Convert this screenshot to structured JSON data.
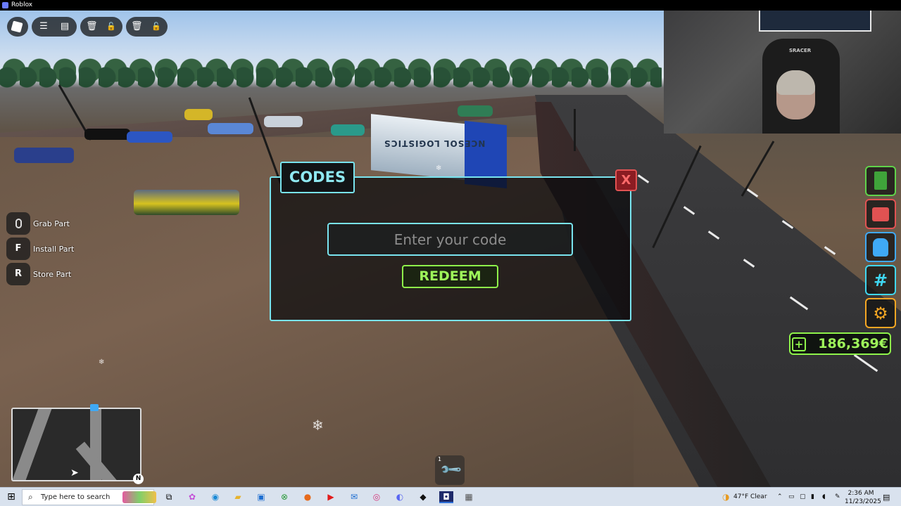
{
  "window": {
    "title": "Roblox"
  },
  "game": {
    "keybinds": [
      {
        "key": "",
        "label": "Grab Part",
        "icon": "mouse-icon"
      },
      {
        "key": "F",
        "label": "Install Part"
      },
      {
        "key": "R",
        "label": "Store Part"
      }
    ],
    "truck_text": "NCESOL LOGISTICS",
    "codes_dialog": {
      "title": "CODES",
      "close_label": "X",
      "input_placeholder": "Enter your code",
      "input_value": "",
      "redeem_label": "REDEEM"
    },
    "currency": {
      "plus_label": "+",
      "value": "186,369€"
    },
    "side_buttons": [
      {
        "name": "book-icon",
        "color": "#5fd34a"
      },
      {
        "name": "shop-icon",
        "color": "#e05252"
      },
      {
        "name": "backpack-icon",
        "color": "#3fa9f5"
      },
      {
        "name": "hashtag-icon",
        "color": "#3fd7f0"
      },
      {
        "name": "gear-icon",
        "color": "#f5a623"
      }
    ],
    "minimap": {
      "compass_label": "N"
    },
    "hotbar": {
      "slot_number": "1"
    },
    "webcam": {
      "chair_brand": "SRACER"
    }
  },
  "taskbar": {
    "search_placeholder": "Type here to search",
    "weather": "47°F  Clear",
    "time": "2:36 AM",
    "date": "11/23/2025"
  }
}
